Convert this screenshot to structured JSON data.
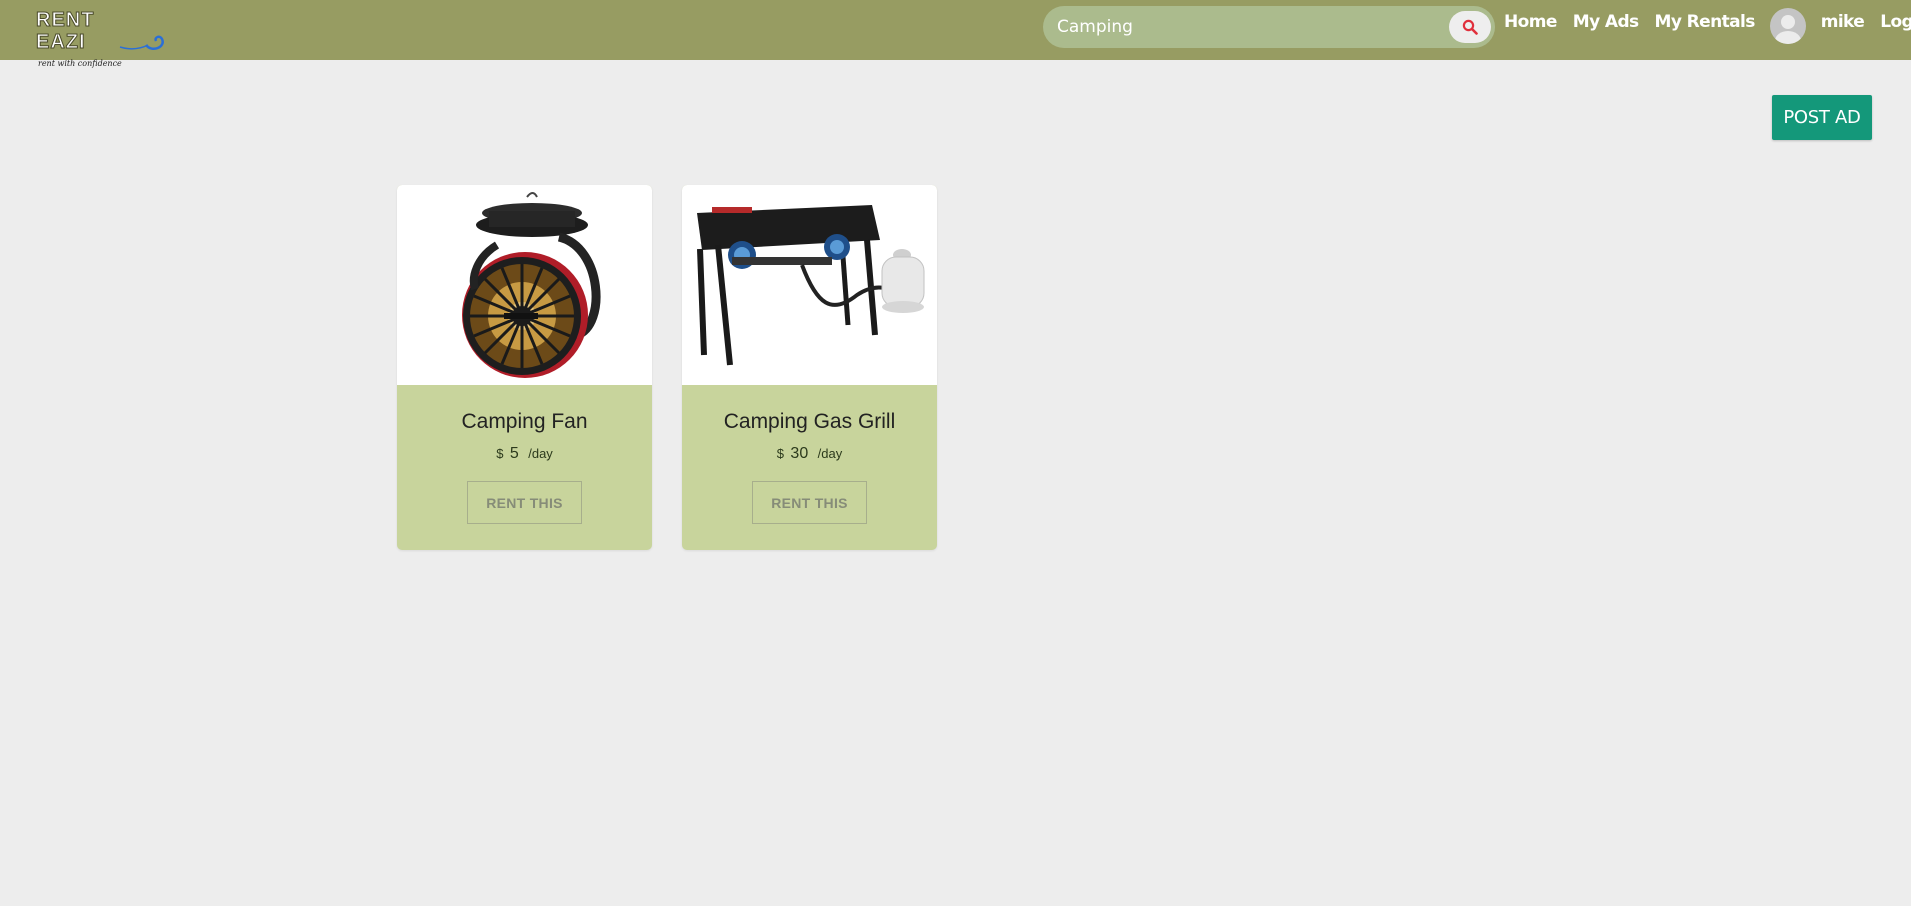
{
  "header": {
    "logo_text": "RENT EAZI",
    "logo_tagline": "rent with confidence",
    "search": {
      "value": "Camping",
      "placeholder": "Search"
    },
    "nav": {
      "home": "Home",
      "my_ads": "My Ads",
      "my_rentals": "My Rentals",
      "username": "mike",
      "logout": "Logout"
    }
  },
  "actions": {
    "post_ad": "POST AD"
  },
  "listings": [
    {
      "title": "Camping Fan",
      "currency": "$",
      "price": "5",
      "unit": "/day",
      "button": "RENT THIS"
    },
    {
      "title": "Camping Gas Grill",
      "currency": "$",
      "price": "30",
      "unit": "/day",
      "button": "RENT THIS"
    }
  ],
  "colors": {
    "navbar": "#979c62",
    "search_bg": "#abbb8d",
    "post_ad": "#14987a",
    "card_body": "#c8d49c",
    "page_bg": "#ededed",
    "search_icon": "#e0303c"
  },
  "icons": {
    "search": "search-icon",
    "avatar": "user-avatar"
  }
}
